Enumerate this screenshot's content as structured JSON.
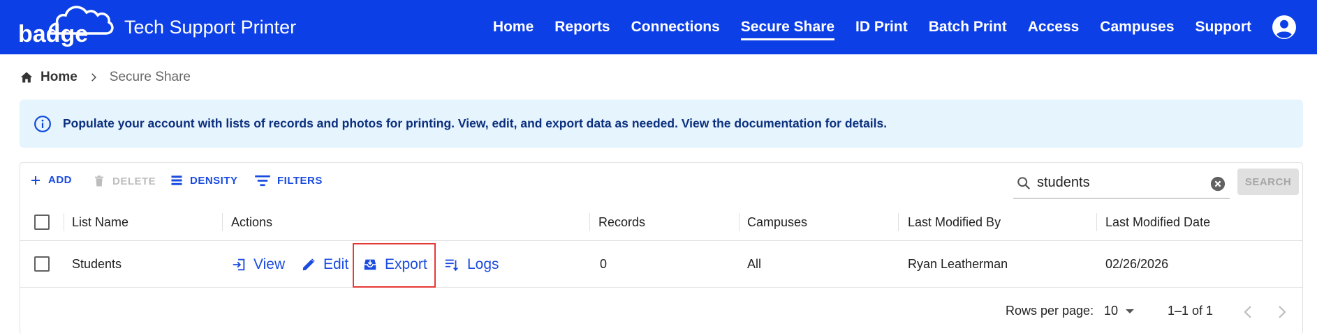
{
  "header": {
    "logo_text": "badge",
    "app_title": "Tech Support Printer",
    "nav": [
      {
        "label": "Home"
      },
      {
        "label": "Reports"
      },
      {
        "label": "Connections"
      },
      {
        "label": "Secure Share",
        "active": true
      },
      {
        "label": "ID Print"
      },
      {
        "label": "Batch Print"
      },
      {
        "label": "Access"
      },
      {
        "label": "Campuses"
      },
      {
        "label": "Support"
      }
    ]
  },
  "breadcrumb": {
    "home": "Home",
    "current": "Secure Share"
  },
  "info": {
    "text": "Populate your account with lists of records and photos for printing. View, edit, and export data as needed. View the documentation for details."
  },
  "toolbar": {
    "add": "ADD",
    "delete": "DELETE",
    "density": "DENSITY",
    "filters": "FILTERS",
    "search_value": "students",
    "search_button": "SEARCH"
  },
  "table": {
    "columns": [
      "List Name",
      "Actions",
      "Records",
      "Campuses",
      "Last Modified By",
      "Last Modified Date"
    ],
    "rows": [
      {
        "list_name": "Students",
        "actions": {
          "view": "View",
          "edit": "Edit",
          "export": "Export",
          "logs": "Logs"
        },
        "records": "0",
        "campuses": "All",
        "last_modified_by": "Ryan Leatherman",
        "last_modified_date": "02/26/2026"
      }
    ]
  },
  "pagination": {
    "rows_per_page_label": "Rows per page:",
    "rows_per_page_value": "10",
    "range": "1–1 of 1"
  },
  "colors": {
    "brand": "#0d3fe6",
    "link": "#1a4be0",
    "info_bg": "#e6f4fd",
    "highlight": "#e53935"
  }
}
